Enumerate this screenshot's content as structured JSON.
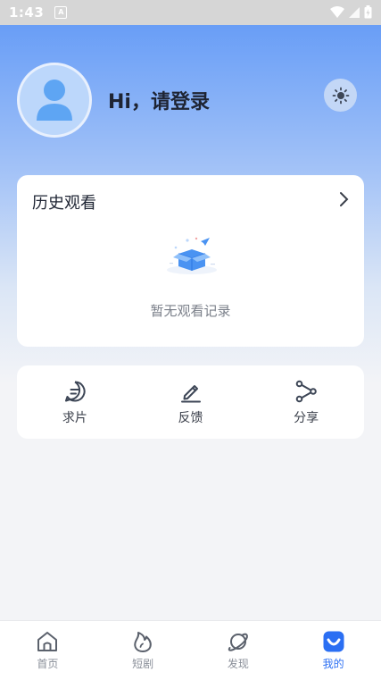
{
  "status_bar": {
    "time": "1:43",
    "app_icon": "A"
  },
  "profile": {
    "login_prompt": "Hi，请登录"
  },
  "history": {
    "title": "历史观看",
    "empty_text": "暂无观看记录"
  },
  "actions": [
    {
      "label": "求片",
      "icon": "chat-icon"
    },
    {
      "label": "反馈",
      "icon": "pencil-icon"
    },
    {
      "label": "分享",
      "icon": "share-icon"
    }
  ],
  "tabs": [
    {
      "label": "首页",
      "icon": "home-icon",
      "active": false
    },
    {
      "label": "短剧",
      "icon": "flame-icon",
      "active": false
    },
    {
      "label": "发现",
      "icon": "planet-icon",
      "active": false
    },
    {
      "label": "我的",
      "icon": "smile-icon",
      "active": true
    }
  ],
  "colors": {
    "accent": "#2b6ff3",
    "header_gradient_top": "#5f97f6"
  }
}
